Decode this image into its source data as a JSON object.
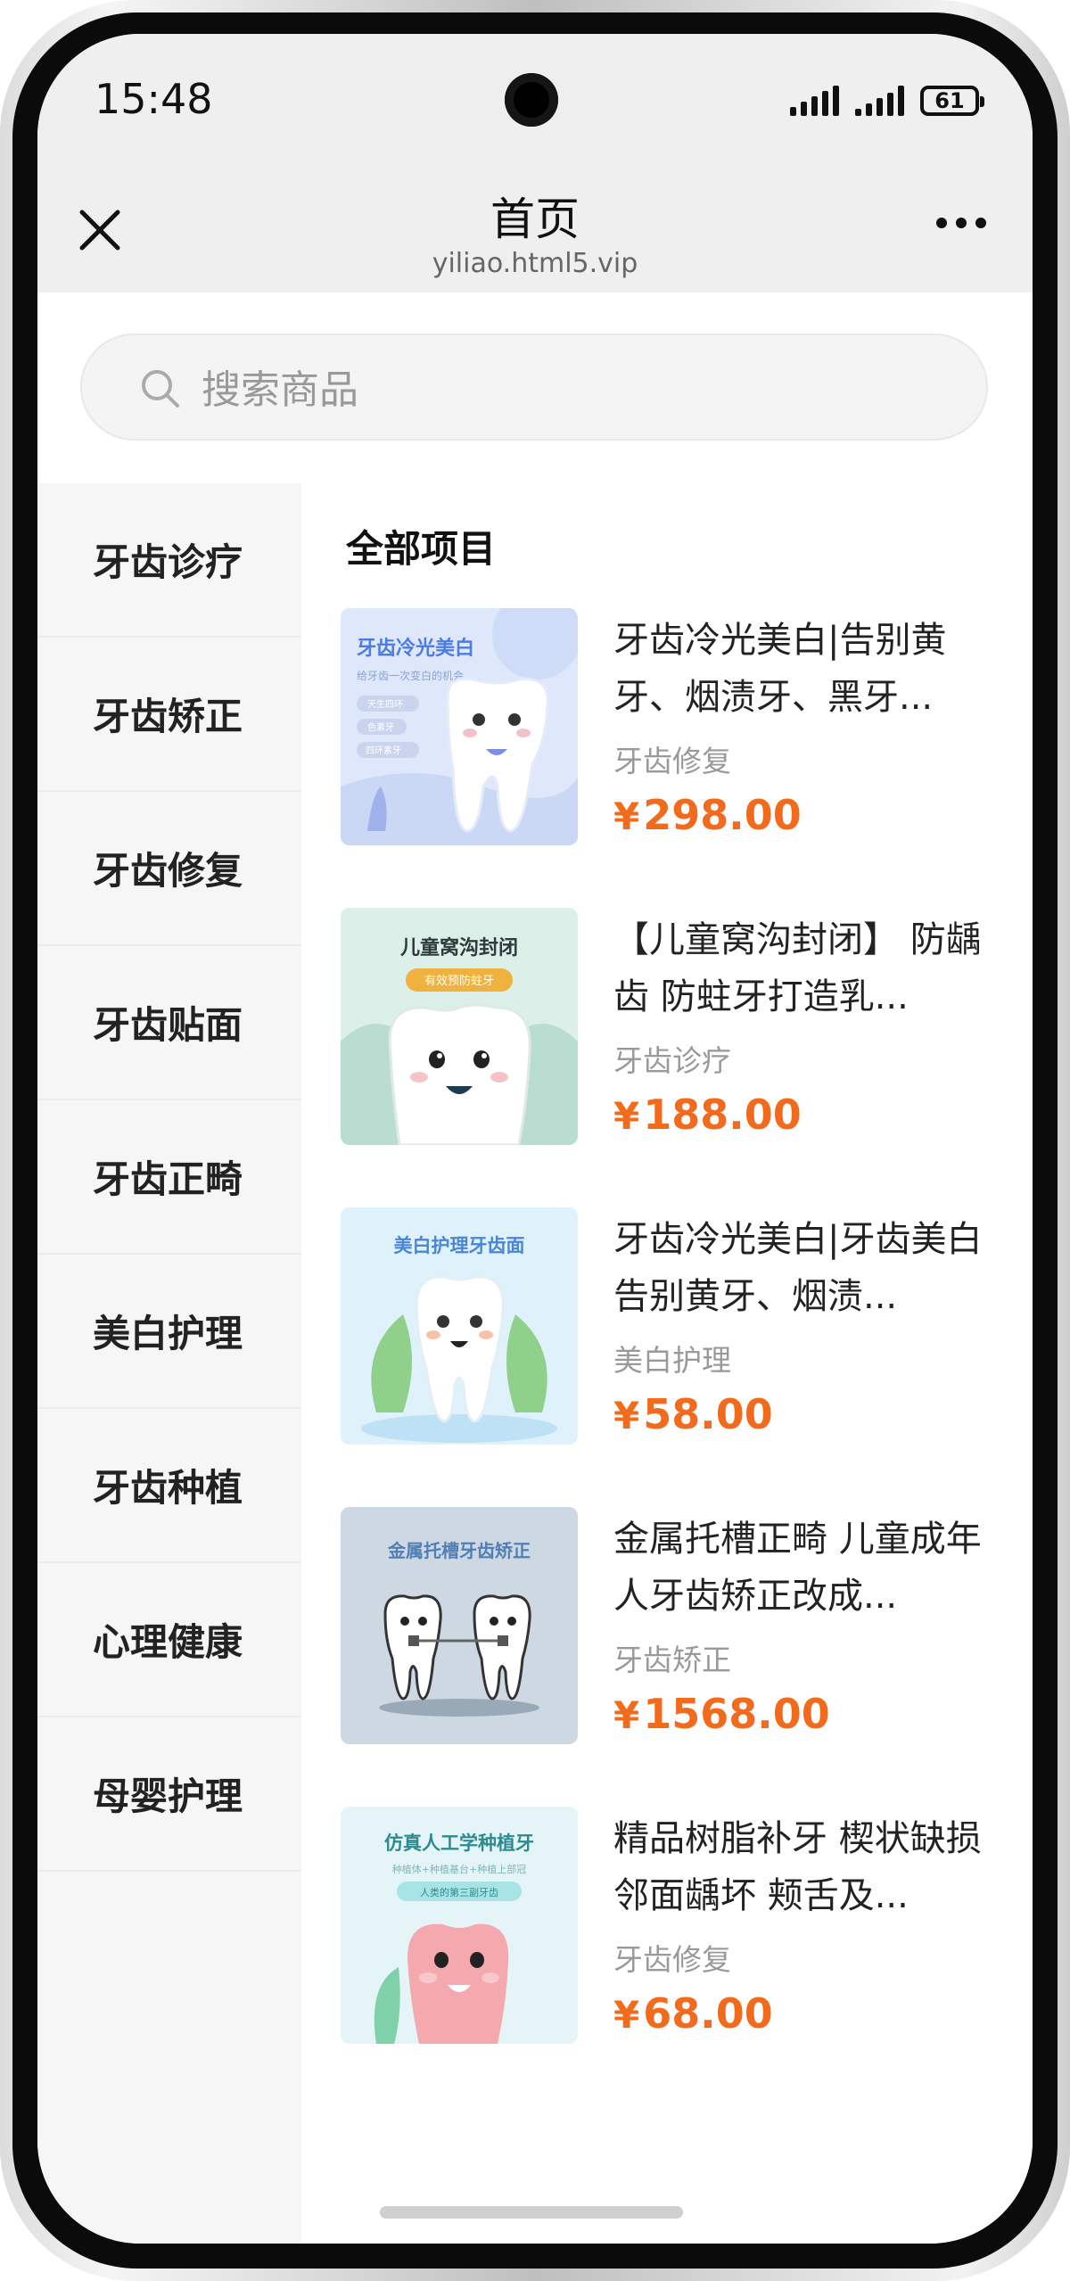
{
  "status_bar": {
    "time": "15:48",
    "battery": "61"
  },
  "nav": {
    "title": "首页",
    "subtitle": "yiliao.html5.vip"
  },
  "search": {
    "placeholder": "搜索商品"
  },
  "sidebar": {
    "items": [
      {
        "label": "牙齿诊疗"
      },
      {
        "label": "牙齿矫正"
      },
      {
        "label": "牙齿修复"
      },
      {
        "label": "牙齿贴面"
      },
      {
        "label": "牙齿正畸"
      },
      {
        "label": "美白护理"
      },
      {
        "label": "牙齿种植"
      },
      {
        "label": "心理健康"
      },
      {
        "label": "母婴护理"
      }
    ]
  },
  "main": {
    "section_title": "全部项目",
    "currency": "¥",
    "products": [
      {
        "title": "牙齿冷光美白|告别黄牙、烟渍牙、黑牙...",
        "category": "牙齿修复",
        "price": "298.00",
        "image": {
          "bg": "#dfe7fb",
          "title": "牙齿冷光美白",
          "subtitle": "给牙齿一次变白的机会",
          "tags": [
            "天生四环",
            "色素牙",
            "四环素牙"
          ],
          "title_color": "#4a7be6"
        }
      },
      {
        "title": "【儿童窝沟封闭】 防龋齿 防蛀牙打造乳...",
        "category": "牙齿诊疗",
        "price": "188.00",
        "image": {
          "bg": "#dcefe8",
          "title": "儿童窝沟封闭",
          "badge": "有效预防蛀牙",
          "title_color": "#2e3b3a"
        }
      },
      {
        "title": "牙齿冷光美白|牙齿美白 告别黄牙、烟渍...",
        "category": "美白护理",
        "price": "58.00",
        "image": {
          "bg": "#dff1fb",
          "title": "美白护理牙齿面",
          "title_color": "#4a86d8"
        }
      },
      {
        "title": "金属托槽正畸 儿童成年人牙齿矫正改成...",
        "category": "牙齿矫正",
        "price": "1568.00",
        "image": {
          "bg": "#cdd8e2",
          "title": "金属托槽牙齿矫正",
          "title_color": "#4f7fb5"
        }
      },
      {
        "title": "精品树脂补牙 楔状缺损邻面龋坏 颊舌及...",
        "category": "牙齿修复",
        "price": "68.00",
        "image": {
          "bg": "#e5f5f7",
          "title": "仿真人工学种植牙",
          "subtitle": "种植体+种植基台+种植上部冠",
          "badge": "人类的第三副牙齿",
          "title_color": "#2d8a8e"
        }
      }
    ]
  },
  "colors": {
    "price": "#f26b1d",
    "sidebar_bg": "#f6f6f6",
    "header_bg": "#efefef"
  },
  "icons": {
    "close": "close-icon",
    "more": "more-icon",
    "search": "search-icon"
  }
}
